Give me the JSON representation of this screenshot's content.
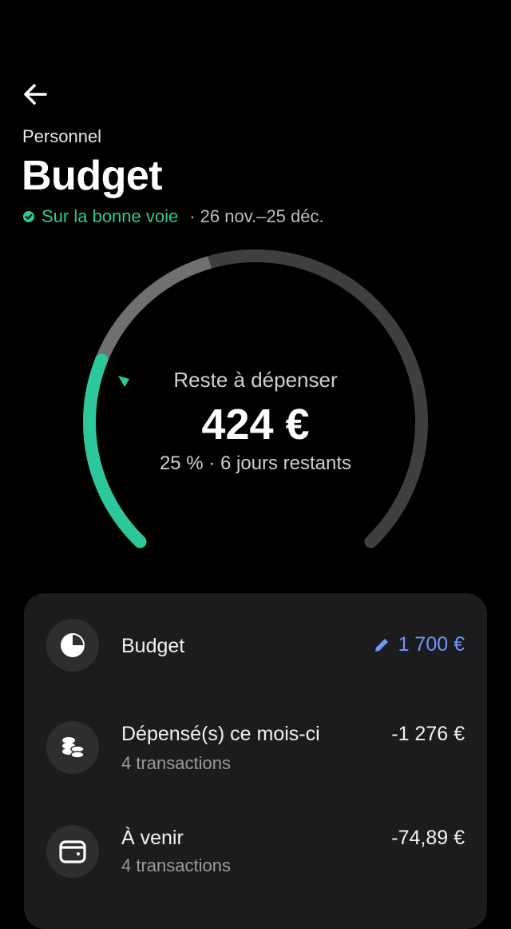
{
  "header": {
    "subtitle": "Personnel",
    "title": "Budget",
    "status": "Sur la bonne voie",
    "period": "· 26 nov.–25 déc."
  },
  "gauge": {
    "label": "Reste à dépenser",
    "amount": "424 €",
    "sub": "25 % · 6 jours restants",
    "remaining_fraction": 0.25
  },
  "summary": {
    "budget": {
      "label": "Budget",
      "value": "1 700 €"
    },
    "spent": {
      "label": "Dépensé(s) ce mois-ci",
      "sub": "4 transactions",
      "value": "-1 276 €"
    },
    "upcoming": {
      "label": "À venir",
      "sub": "4 transactions",
      "value": "-74,89 €"
    }
  },
  "colors": {
    "accent_green": "#2cc79a",
    "accent_blue": "#6f95f7",
    "card_bg": "#1c1c1e"
  },
  "icons": {
    "back": "arrow-left-icon",
    "status": "check-circle-icon",
    "budget": "pie-chart-icon",
    "spent": "coins-icon",
    "upcoming": "wallet-icon",
    "edit": "pencil-icon"
  }
}
